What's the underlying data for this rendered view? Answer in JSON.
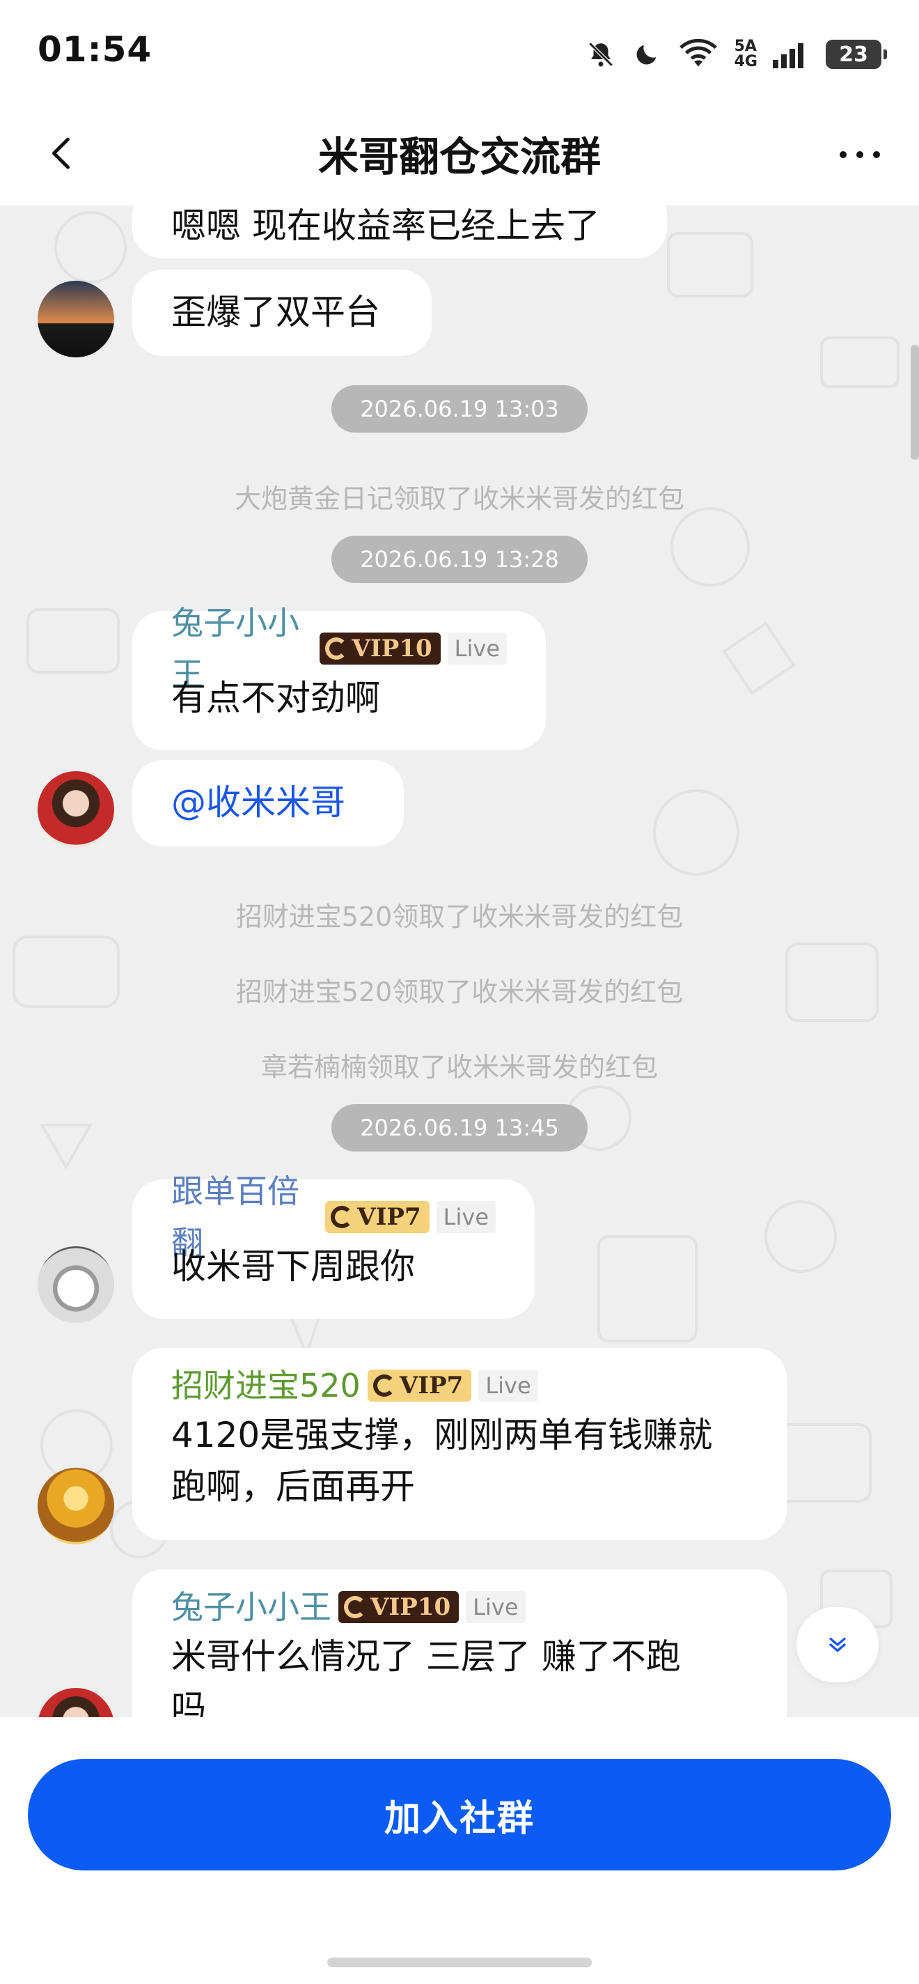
{
  "status_bar": {
    "time": "01:54",
    "network_top": "5A",
    "network_bottom": "4G",
    "battery": "23"
  },
  "header": {
    "title": "米哥翻仓交流群"
  },
  "messages": [
    {
      "text": "嗯嗯 现在收益率已经上去了"
    },
    {
      "text": "歪爆了双平台"
    },
    {
      "sender": "兔子小小王",
      "vip": "VIP10",
      "live": "Live",
      "text": "有点不对劲啊"
    },
    {
      "text": "@收米米哥"
    },
    {
      "sender": "跟单百倍翻",
      "vip": "VIP7",
      "live": "Live",
      "text": "收米哥下周跟你"
    },
    {
      "sender": "招财进宝520",
      "vip": "VIP7",
      "live": "Live",
      "text_line1": "4120是强支撑，刚刚两单有钱赚就",
      "text_line2": "跑啊，后面再开"
    },
    {
      "sender": "兔子小小王",
      "vip": "VIP10",
      "live": "Live",
      "text_line1": "米哥什么情况了 三层了 赚了不跑",
      "text_line2": "吗"
    }
  ],
  "timestamps": [
    "2026.06.19 13:03",
    "2026.06.19 13:28",
    "2026.06.19 13:45"
  ],
  "system_messages": [
    "大炮黄金日记领取了收米米哥发的红包",
    "招财进宝520领取了收米米哥发的红包",
    "招财进宝520领取了收米米哥发的红包",
    "章若楠楠领取了收米米哥发的红包"
  ],
  "join_button": "加入社群",
  "colors": {
    "accent": "#0a5cf5",
    "mention": "#1a56e8",
    "name_teal": "#4d8fa3",
    "name_blue": "#5b7fc0",
    "name_green": "#5e9a2f"
  }
}
